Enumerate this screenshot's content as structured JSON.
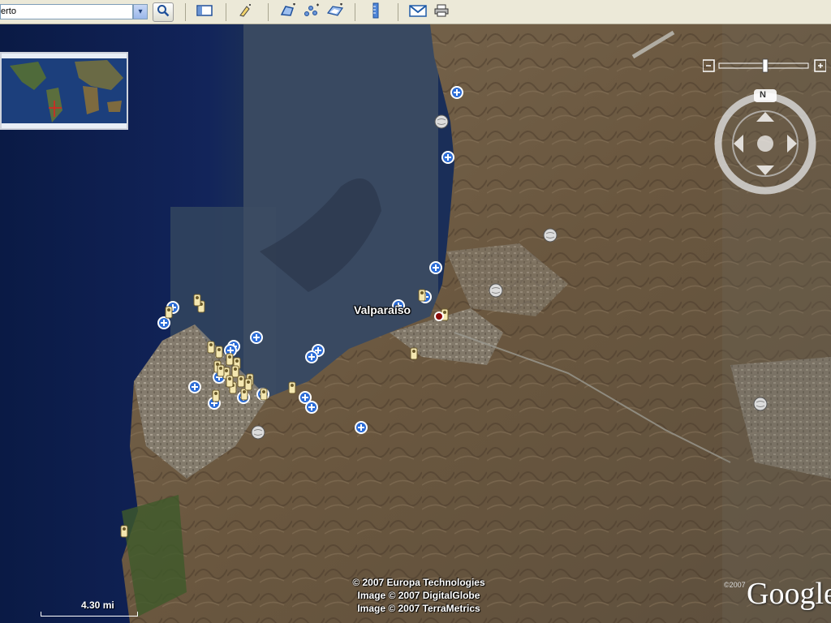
{
  "toolbar": {
    "search_value": "erto",
    "dropdown_glyph": "▾",
    "buttons": [
      {
        "icon": "magnifier-icon",
        "glyph": "🔍"
      },
      {
        "icon": "sidebar-toggle-icon",
        "glyph": "▭"
      },
      {
        "icon": "add-placemark-icon",
        "glyph": "✎"
      },
      {
        "icon": "add-polygon-icon",
        "glyph": "⬠"
      },
      {
        "icon": "add-path-icon",
        "glyph": "⁂"
      },
      {
        "icon": "image-overlay-icon",
        "glyph": "▱"
      },
      {
        "icon": "ruler-icon",
        "glyph": "▮"
      },
      {
        "icon": "email-icon",
        "glyph": "M"
      },
      {
        "icon": "print-icon",
        "glyph": "⎙"
      }
    ]
  },
  "map": {
    "place_label": "Valparaíso",
    "copyright": [
      "© 2007 Europa Technologies",
      "Image © 2007 DigitalGlobe",
      "Image © 2007 TerraMetrics"
    ],
    "scale": "4.30 mi",
    "logo_year": "©2007",
    "logo": "Google",
    "compass_letter": "N"
  },
  "colors": {
    "ocean_deep": "#0e1e4a",
    "ocean_shallow": "#3b4f6a",
    "land": "#6e5c45",
    "toolbar": "#ece9d8",
    "marker_blue": "#2a6bd6"
  },
  "markers": {
    "blue_pin_count": 20,
    "photo_pin_count": 24,
    "globe_pin_count": 5
  }
}
